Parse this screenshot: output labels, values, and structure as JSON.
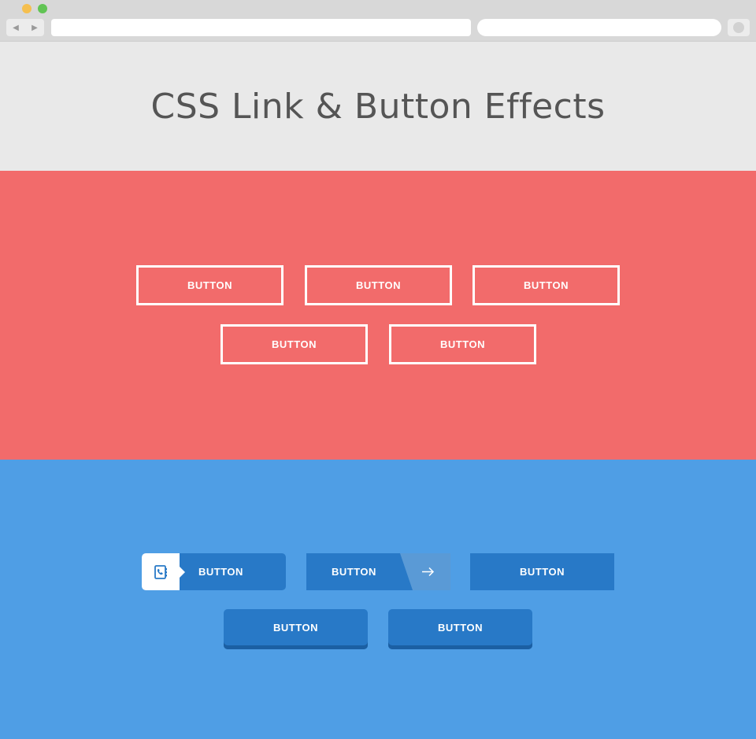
{
  "header": {
    "title": "CSS Link & Button Effects"
  },
  "red_section": {
    "buttons": [
      "BUTTON",
      "BUTTON",
      "BUTTON",
      "BUTTON",
      "BUTTON"
    ]
  },
  "blue_section": {
    "icon_button": {
      "label": "BUTTON",
      "icon": "phone-book-icon"
    },
    "arrow_button": {
      "label": "BUTTON",
      "icon": "arrow-right-icon"
    },
    "plain_button": {
      "label": "BUTTON"
    },
    "raised_buttons": [
      "BUTTON",
      "BUTTON"
    ]
  },
  "colors": {
    "header_bg": "#e9e9e9",
    "red_bg": "#f26b6b",
    "blue_bg": "#4f9ee5",
    "button_blue": "#2879c7",
    "button_blue_shadow": "#1b5fa3"
  }
}
